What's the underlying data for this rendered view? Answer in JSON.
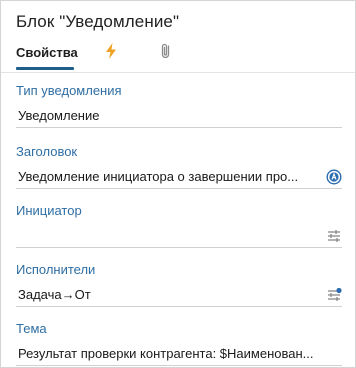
{
  "panel": {
    "title": "Блок \"Уведомление\""
  },
  "tabs": [
    {
      "label": "Свойства",
      "active": true
    },
    {
      "icon": "lightning-icon",
      "color": "#f0a020"
    },
    {
      "icon": "paperclip-icon",
      "color": "#8a8a8a"
    }
  ],
  "fields": [
    {
      "label": "Тип уведомления",
      "value": "Уведомление",
      "icon": ""
    },
    {
      "label": "Заголовок",
      "value": "Уведомление инициатора о завершении про...",
      "icon": "text-template-icon"
    },
    {
      "label": "Инициатор",
      "value": "",
      "icon": "settings-sliders-icon"
    },
    {
      "label": "Исполнители",
      "value": "Задача→От",
      "icon": "settings-sliders-active-icon"
    },
    {
      "label": "Тема",
      "value": "Результат проверки контрагента: $Наименован...",
      "icon": ""
    }
  ],
  "colors": {
    "label": "#2f6ea3",
    "accent": "#1f5f8b",
    "icon": "#2b6cb0"
  }
}
